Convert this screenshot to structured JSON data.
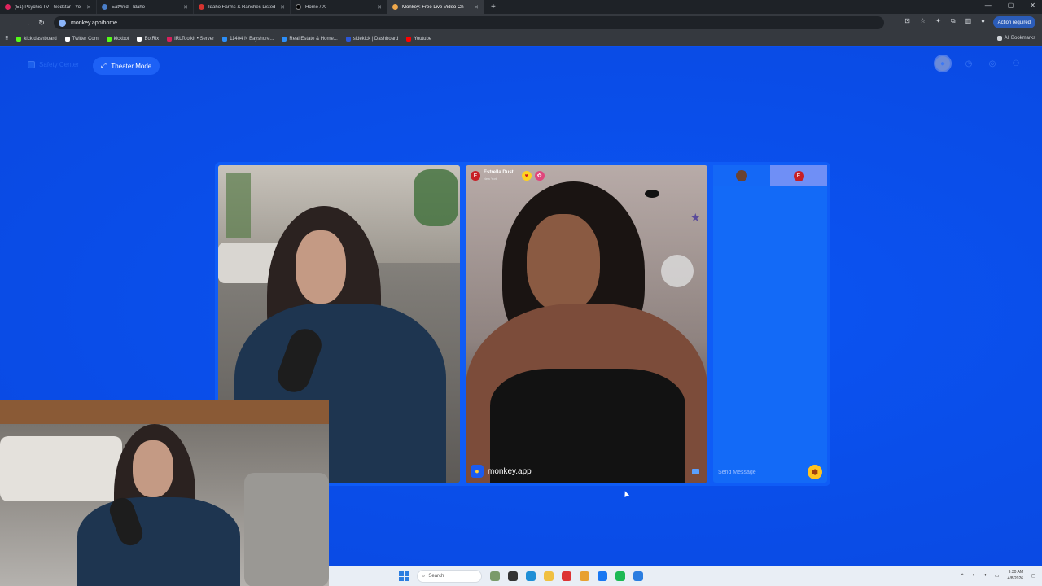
{
  "browser": {
    "tabs": [
      {
        "label": "(51) Psychic TV - Godstar - Yo",
        "color": "#e0245e"
      },
      {
        "label": "EatWild - Idaho",
        "color": "#4a7ec9"
      },
      {
        "label": "Idaho Farms & Ranches Listed",
        "color": "#d6332f"
      },
      {
        "label": "Home / X",
        "color": "#000000"
      },
      {
        "label": "Monkey: Free Live Video Ch",
        "color": "#f0a84b",
        "active": true
      }
    ],
    "url": "monkey.app/home",
    "action_required": "Action required",
    "bookmarks": [
      {
        "label": "kick dashboard",
        "color": "#53fc18"
      },
      {
        "label": "Twitter Com",
        "color": "#ffffff"
      },
      {
        "label": "kickbot",
        "color": "#53fc18"
      },
      {
        "label": "BotRix",
        "color": "#ffffff"
      },
      {
        "label": "IRLToolkit • Server",
        "color": "#d91f5c"
      },
      {
        "label": "11404 N Bayshore...",
        "color": "#2c8ef8"
      },
      {
        "label": "Real Estate & Home...",
        "color": "#2c8ef8"
      },
      {
        "label": "sidekick | Dashboard",
        "color": "#2a56d8"
      },
      {
        "label": "Youtube",
        "color": "#ff0000"
      }
    ],
    "all_bookmarks": "All Bookmarks"
  },
  "header": {
    "safety_center": "Safety Center",
    "theater_mode": "Theater Mode"
  },
  "call": {
    "caller_initial": "E",
    "caller_name": "Estrella Dust",
    "caller_location": "New York",
    "watermark": "monkey.app"
  },
  "chat": {
    "tab_initial": "E",
    "placeholder": "Send Message"
  },
  "taskbar": {
    "search_label": "Search",
    "time": "9:30 AM",
    "date": "4/8/2026"
  }
}
